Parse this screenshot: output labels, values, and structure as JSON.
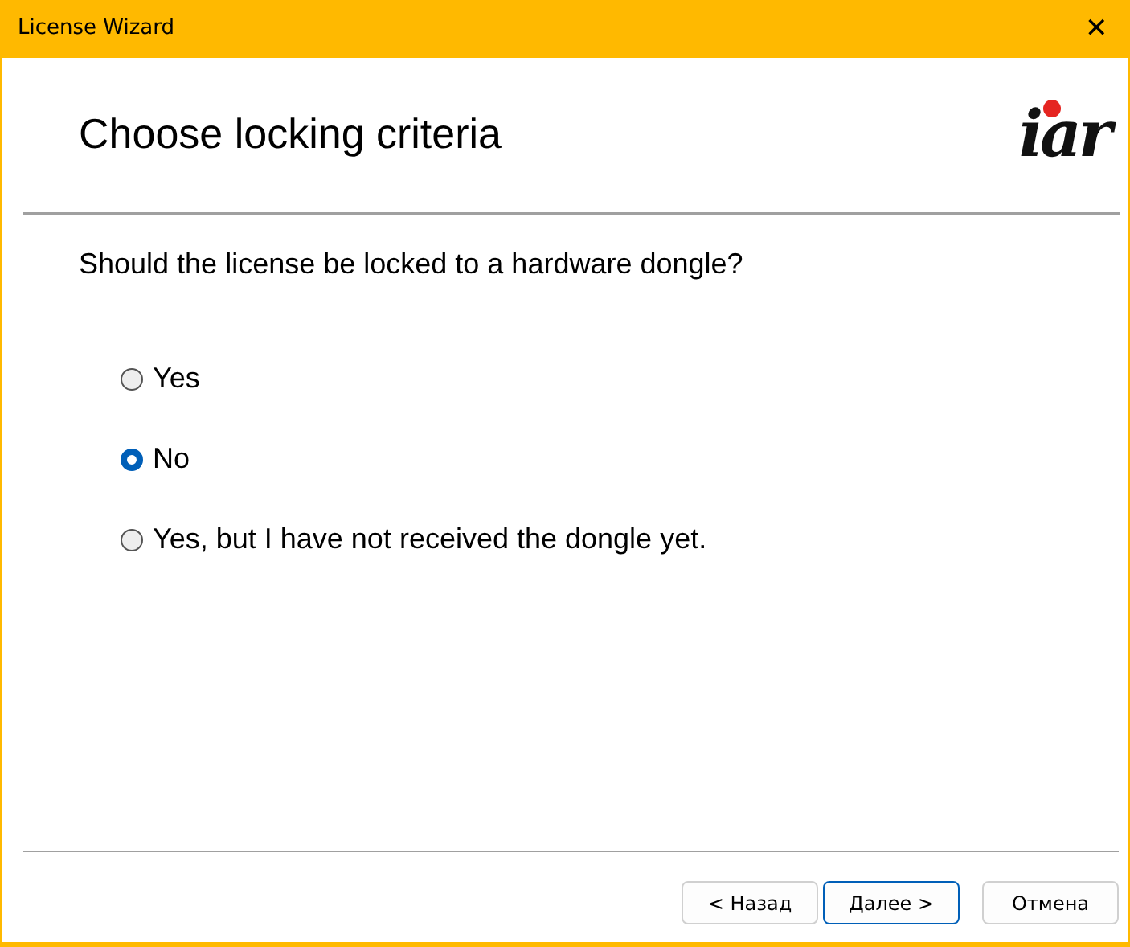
{
  "window": {
    "title": "License Wizard",
    "close": "✕"
  },
  "header": {
    "title": "Choose locking criteria",
    "logo": "iar"
  },
  "question": "Should the license be locked to a hardware dongle?",
  "options": [
    {
      "label": "Yes",
      "selected": false
    },
    {
      "label": "No",
      "selected": true
    },
    {
      "label": "Yes, but I have not received the dongle yet.",
      "selected": false
    }
  ],
  "buttons": [
    {
      "label": "< Назад",
      "default": false
    },
    {
      "label": "Далее >",
      "default": true
    },
    {
      "label": "Отмена",
      "default": false
    }
  ]
}
